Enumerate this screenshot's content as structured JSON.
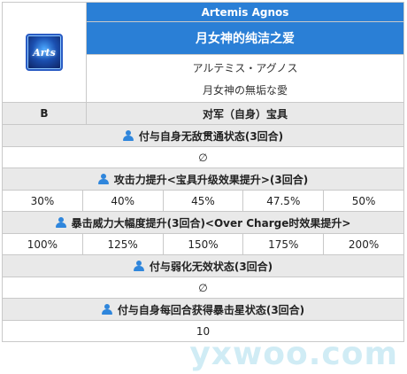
{
  "header": {
    "english_name": "Artemis Agnos",
    "chinese_name": "月女神的纯洁之爱",
    "japanese_name": "アルテミス・アグノス",
    "japanese_kanji": "月女神の無垢な愛",
    "card_icon_text": "Arts",
    "rank": "B",
    "type": "对军（自身）宝具"
  },
  "effects": [
    {
      "label": "付与自身无敌贯通状态(3回合)",
      "values": [
        "∅"
      ]
    },
    {
      "label": "攻击力提升<宝具升级效果提升>(3回合)",
      "values": [
        "30%",
        "40%",
        "45%",
        "47.5%",
        "50%"
      ]
    },
    {
      "label": "暴击威力大幅度提升(3回合)<Over Charge时效果提升>",
      "values": [
        "100%",
        "125%",
        "150%",
        "175%",
        "200%"
      ]
    },
    {
      "label": "付与弱化无效状态(3回合)",
      "values": [
        "∅"
      ]
    },
    {
      "label": "付与自身每回合获得暴击星状态(3回合)",
      "values": [
        "10"
      ]
    }
  ],
  "watermark": "yxwoo.com",
  "colors": {
    "header_blue": "#2a7fd6",
    "gray_row": "#e9e9e9",
    "icon_blue": "#2f86dc"
  }
}
